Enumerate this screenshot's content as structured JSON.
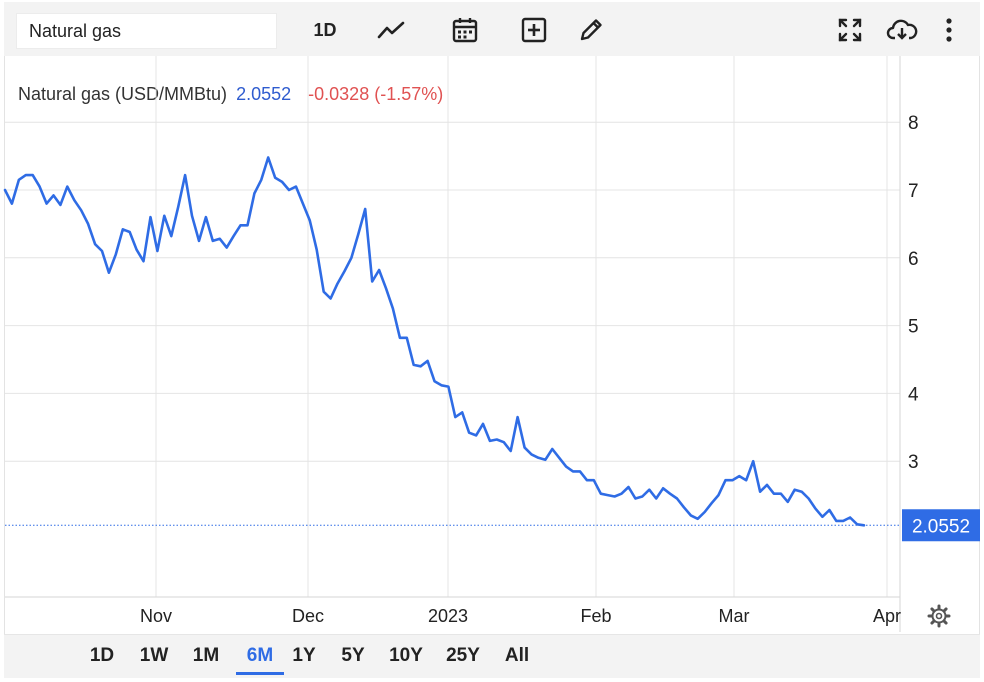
{
  "toolbar": {
    "search_value": "Natural gas",
    "interval_label": "1D",
    "icons": [
      "chart-type-icon",
      "calendar-icon",
      "add-indicator-icon",
      "draw-icon",
      "fullscreen-icon",
      "download-icon",
      "more-icon"
    ]
  },
  "legend": {
    "name": "Natural gas (USD/MMBtu)",
    "price": "2.0552",
    "change": "-0.0328 (-1.57%)"
  },
  "range_tabs": [
    {
      "label": "1D",
      "active": false
    },
    {
      "label": "1W",
      "active": false
    },
    {
      "label": "1M",
      "active": false
    },
    {
      "label": "6M",
      "active": true
    },
    {
      "label": "1Y",
      "active": false
    },
    {
      "label": "5Y",
      "active": false
    },
    {
      "label": "10Y",
      "active": false
    },
    {
      "label": "25Y",
      "active": false
    },
    {
      "label": "All",
      "active": false
    }
  ],
  "colors": {
    "line": "#2f6ce5",
    "price_badge": "#2f6ce5",
    "change_negative": "#e05252",
    "price_text": "#2f5ccf",
    "grid": "#e4e4e4",
    "toolbar_bg": "#f3f3f3"
  },
  "chart_data": {
    "type": "line",
    "series": [
      {
        "values": [
          7.0,
          6.8,
          7.15,
          7.22,
          7.22,
          7.05,
          6.8,
          6.92,
          6.78,
          7.05,
          6.85,
          6.7,
          6.5,
          6.2,
          6.1,
          5.78,
          6.05,
          6.42,
          6.38,
          6.12,
          5.95,
          6.6,
          6.1,
          6.62,
          6.32,
          6.75,
          7.22,
          6.62,
          6.25,
          6.6,
          6.25,
          6.28,
          6.15,
          6.32,
          6.48,
          6.48,
          6.95,
          7.15,
          7.48,
          7.18,
          7.12,
          7.0,
          7.05,
          6.8,
          6.55,
          6.12,
          5.5,
          5.4,
          5.62,
          5.8,
          6.0,
          6.35,
          6.72,
          5.65,
          5.82,
          5.55,
          5.25,
          4.82,
          4.82,
          4.42,
          4.4,
          4.48,
          4.18,
          4.12,
          4.1,
          3.65,
          3.72,
          3.42,
          3.38,
          3.55,
          3.3,
          3.32,
          3.28,
          3.15,
          3.65,
          3.2,
          3.1,
          3.05,
          3.02,
          3.18,
          3.05,
          2.92,
          2.85,
          2.85,
          2.72,
          2.72,
          2.52,
          2.5,
          2.48,
          2.52,
          2.62,
          2.45,
          2.48,
          2.58,
          2.45,
          2.6,
          2.52,
          2.45,
          2.32,
          2.2,
          2.15,
          2.25,
          2.38,
          2.5,
          2.72,
          2.72,
          2.78,
          2.72,
          3.0,
          2.55,
          2.65,
          2.52,
          2.52,
          2.4,
          2.58,
          2.55,
          2.45,
          2.3,
          2.18,
          2.28,
          2.12,
          2.12,
          2.17,
          2.07,
          2.0552
        ]
      }
    ],
    "x_ticks": [
      "Nov",
      "Dec",
      "2023",
      "Feb",
      "Mar",
      "Apr"
    ],
    "y_ticks": [
      3,
      4,
      5,
      6,
      7,
      8
    ],
    "ylim": [
      1.0,
      8.9
    ],
    "last_value_label": "2.0552",
    "grid": true,
    "y_axis_side": "right"
  }
}
